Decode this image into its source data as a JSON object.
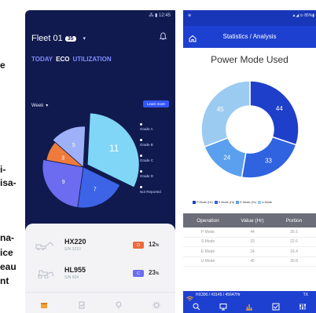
{
  "left_text": [
    "e",
    "i-",
    "isa-",
    "na-",
    "ice",
    "eau",
    "nt"
  ],
  "phone1": {
    "status": "⁂ ▮ 12:45",
    "fleet_title": "Fleet 01",
    "fleet_badge": "35",
    "tabs": [
      "TODAY",
      "ECO",
      "UTILIZATION"
    ],
    "active_tab": "ECO",
    "period": "Week",
    "learn_more": "Learn more",
    "legend": [
      "Grade A",
      "Grade B",
      "Grade C",
      "Grade D",
      "Not Reported"
    ],
    "pie": [
      {
        "label": "11",
        "value": 11,
        "color": "#7fd6f7"
      },
      {
        "label": "7",
        "value": 7,
        "color": "#3d63e6"
      },
      {
        "label": "9",
        "value": 9,
        "color": "#6b6cf0"
      },
      {
        "label": "3",
        "value": 3,
        "color": "#ee7b3c"
      },
      {
        "label": "5",
        "value": 5,
        "color": "#9eb0f7"
      }
    ],
    "machines": [
      {
        "model": "HX220",
        "sn": "S/N 3210",
        "grade": "D",
        "grade_color": "#ee6a3c",
        "pct": "12",
        "unit": "%"
      },
      {
        "model": "HL955",
        "sn": "S/N 934",
        "grade": "C",
        "grade_color": "#6b6cf0",
        "pct": "23",
        "unit": "%"
      }
    ]
  },
  "phone2": {
    "status_left": "⊕",
    "status_right": "▲◢ ⊙ 85%▮",
    "title": "Statistics / Analysis",
    "chart_title": "Power Mode Used",
    "footer_text": "HX300 / #3145 / 45647Hr",
    "footer_tx": "TX",
    "table_headers": [
      "Operation",
      "Value (Hr)",
      "Portion"
    ],
    "table_rows": [
      [
        "P Mode",
        "44",
        "30.1"
      ],
      [
        "S Mode",
        "33",
        "22.6"
      ],
      [
        "E Mode",
        "24",
        "16.4"
      ],
      [
        "U Mode",
        "45",
        "30.8"
      ]
    ]
  },
  "chart_data": {
    "type": "pie",
    "title": "Power Mode Used",
    "categories": [
      "P Mode (Hr)",
      "S Mode (Hr)",
      "E Mode (Hr)",
      "U Mode"
    ],
    "values": [
      44,
      33,
      24,
      45
    ],
    "colors": [
      "#1e3fc9",
      "#2f63e0",
      "#5aa0ee",
      "#9ccbf2"
    ]
  }
}
